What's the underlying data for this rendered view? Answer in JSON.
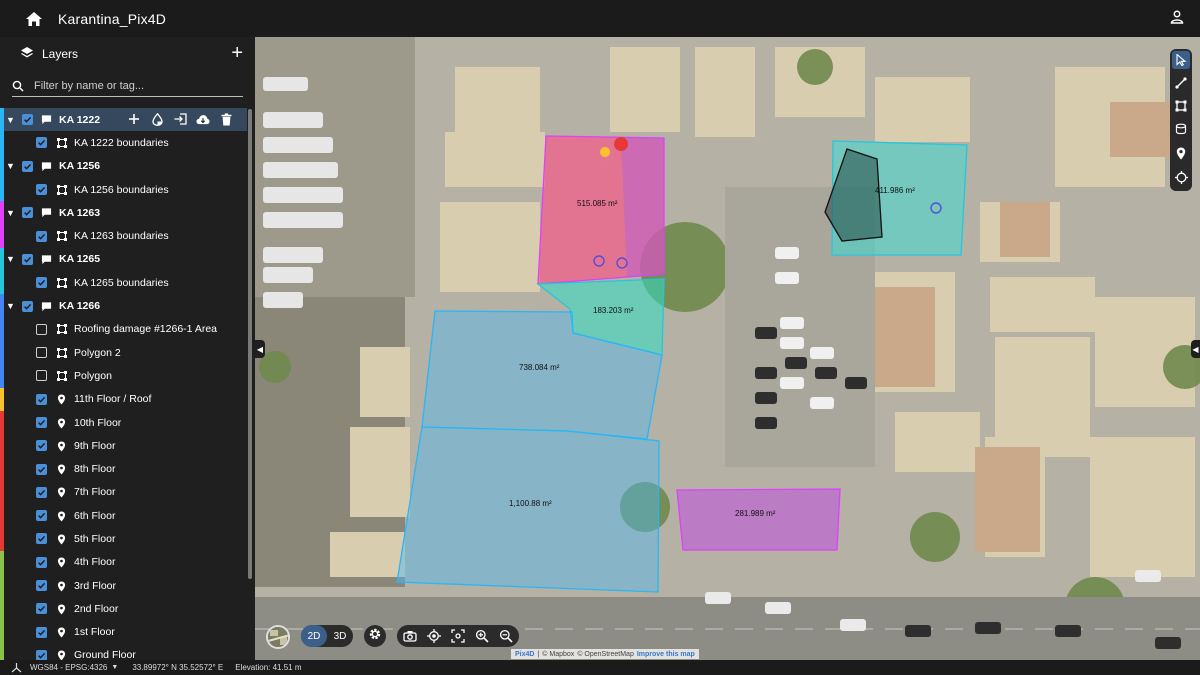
{
  "app": {
    "title": "Karantina_Pix4D"
  },
  "sidebar": {
    "header": "Layers",
    "filter_placeholder": "Filter by name or tag...",
    "items": [
      {
        "type": "group",
        "label": "KA 1222",
        "checked": true,
        "active": true,
        "color": "#29b6f6"
      },
      {
        "type": "child",
        "label": "KA 1222 boundaries",
        "checked": true,
        "icon": "polygon-icon",
        "color": "#29b6f6"
      },
      {
        "type": "group",
        "label": "KA 1256",
        "checked": true,
        "color": "#29b6f6"
      },
      {
        "type": "child",
        "label": "KA 1256 boundaries",
        "checked": true,
        "icon": "polygon-icon",
        "color": "#29b6f6"
      },
      {
        "type": "group",
        "label": "KA 1263",
        "checked": true,
        "color": "#e040fb"
      },
      {
        "type": "child",
        "label": "KA 1263 boundaries",
        "checked": true,
        "icon": "polygon-icon",
        "color": "#e040fb"
      },
      {
        "type": "group",
        "label": "KA 1265",
        "checked": true,
        "color": "#26c6da"
      },
      {
        "type": "child",
        "label": "KA 1265 boundaries",
        "checked": true,
        "icon": "polygon-icon",
        "color": "#26c6da"
      },
      {
        "type": "group",
        "label": "KA 1266",
        "checked": true,
        "color": "#4285f4"
      },
      {
        "type": "child",
        "label": "Roofing damage #1266-1 Area",
        "checked": false,
        "icon": "polygon-icon",
        "color": "#4285f4"
      },
      {
        "type": "child",
        "label": "Polygon 2",
        "checked": false,
        "icon": "polygon-icon",
        "color": "#4285f4"
      },
      {
        "type": "child",
        "label": "Polygon",
        "checked": false,
        "icon": "polygon-icon",
        "color": "#4285f4"
      },
      {
        "type": "child",
        "label": "11th Floor / Roof",
        "checked": true,
        "icon": "pin-icon",
        "color": "#fbc02d"
      },
      {
        "type": "child",
        "label": "10th Floor",
        "checked": true,
        "icon": "pin-icon",
        "color": "#e53935"
      },
      {
        "type": "child",
        "label": "9th Floor",
        "checked": true,
        "icon": "pin-icon",
        "color": "#e53935"
      },
      {
        "type": "child",
        "label": "8th Floor",
        "checked": true,
        "icon": "pin-icon",
        "color": "#e53935"
      },
      {
        "type": "child",
        "label": "7th Floor",
        "checked": true,
        "icon": "pin-icon",
        "color": "#e53935"
      },
      {
        "type": "child",
        "label": "6th Floor",
        "checked": true,
        "icon": "pin-icon",
        "color": "#e53935"
      },
      {
        "type": "child",
        "label": "5th Floor",
        "checked": true,
        "icon": "pin-icon",
        "color": "#e53935"
      },
      {
        "type": "child",
        "label": "4th Floor",
        "checked": true,
        "icon": "pin-icon",
        "color": "#8bc34a"
      },
      {
        "type": "child",
        "label": "3rd Floor",
        "checked": true,
        "icon": "pin-icon",
        "color": "#8bc34a"
      },
      {
        "type": "child",
        "label": "2nd Floor",
        "checked": true,
        "icon": "pin-icon",
        "color": "#8bc34a"
      },
      {
        "type": "child",
        "label": "1st Floor",
        "checked": true,
        "icon": "pin-icon",
        "color": "#8bc34a"
      },
      {
        "type": "child",
        "label": "Ground Floor",
        "checked": true,
        "icon": "pin-icon",
        "color": "#8bc34a"
      }
    ]
  },
  "map": {
    "areas": {
      "a1": "515.085 m²",
      "a2": "411.986 m²",
      "a3": "183.203 m²",
      "a4": "738.084 m²",
      "a5": "1,100.88 m²",
      "a6": "281.989 m²"
    },
    "view_mode": {
      "d2": "2D",
      "d3": "3D",
      "selected": "2D"
    },
    "attribution": {
      "pix4d": "Pix4D",
      "sep": "|",
      "mapbox": "© Mapbox",
      "osm": "© OpenStreetMap",
      "improve": "Improve this map"
    }
  },
  "status": {
    "crs": "WGS84 - EPSG:4326",
    "coords": "33.89972° N 35.52572° E",
    "elevation": "Elevation: 41.51 m"
  }
}
